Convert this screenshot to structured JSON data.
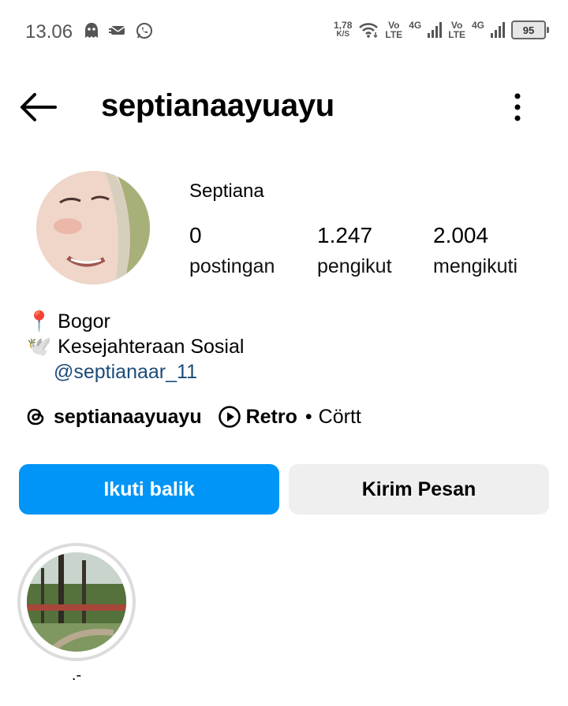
{
  "status_bar": {
    "time": "13.06",
    "net_speed_value": "1,78",
    "net_speed_unit": "K/S",
    "sim1_label": "Vo",
    "sim1_sub": "LTE",
    "sim1_network": "4G",
    "sim2_label": "Vo",
    "sim2_sub": "LTE",
    "sim2_network": "4G",
    "battery": "95"
  },
  "header": {
    "username": "septianaayuayu"
  },
  "profile": {
    "display_name": "Septiana",
    "stats": [
      {
        "value": "0",
        "label": "postingan"
      },
      {
        "value": "1.247",
        "label": "pengikut"
      },
      {
        "value": "2.004",
        "label": "mengikuti"
      }
    ],
    "bio": [
      {
        "emoji": "📍",
        "text": "Bogor"
      },
      {
        "emoji": "🕊️",
        "text": "Kesejahteraan Sosial"
      }
    ],
    "mention": "@septianaar_11"
  },
  "threads_row": {
    "threads_username": "septianaayuayu",
    "music_title": "Retro",
    "separator": "•",
    "music_artist": "Cörtt"
  },
  "actions": {
    "follow_back": "Ikuti balik",
    "message": "Kirim Pesan"
  },
  "highlights": [
    {
      "label": ".-"
    }
  ],
  "colors": {
    "primary_button": "#0095f6",
    "secondary_button": "#efefef",
    "link": "#1c4b78"
  }
}
